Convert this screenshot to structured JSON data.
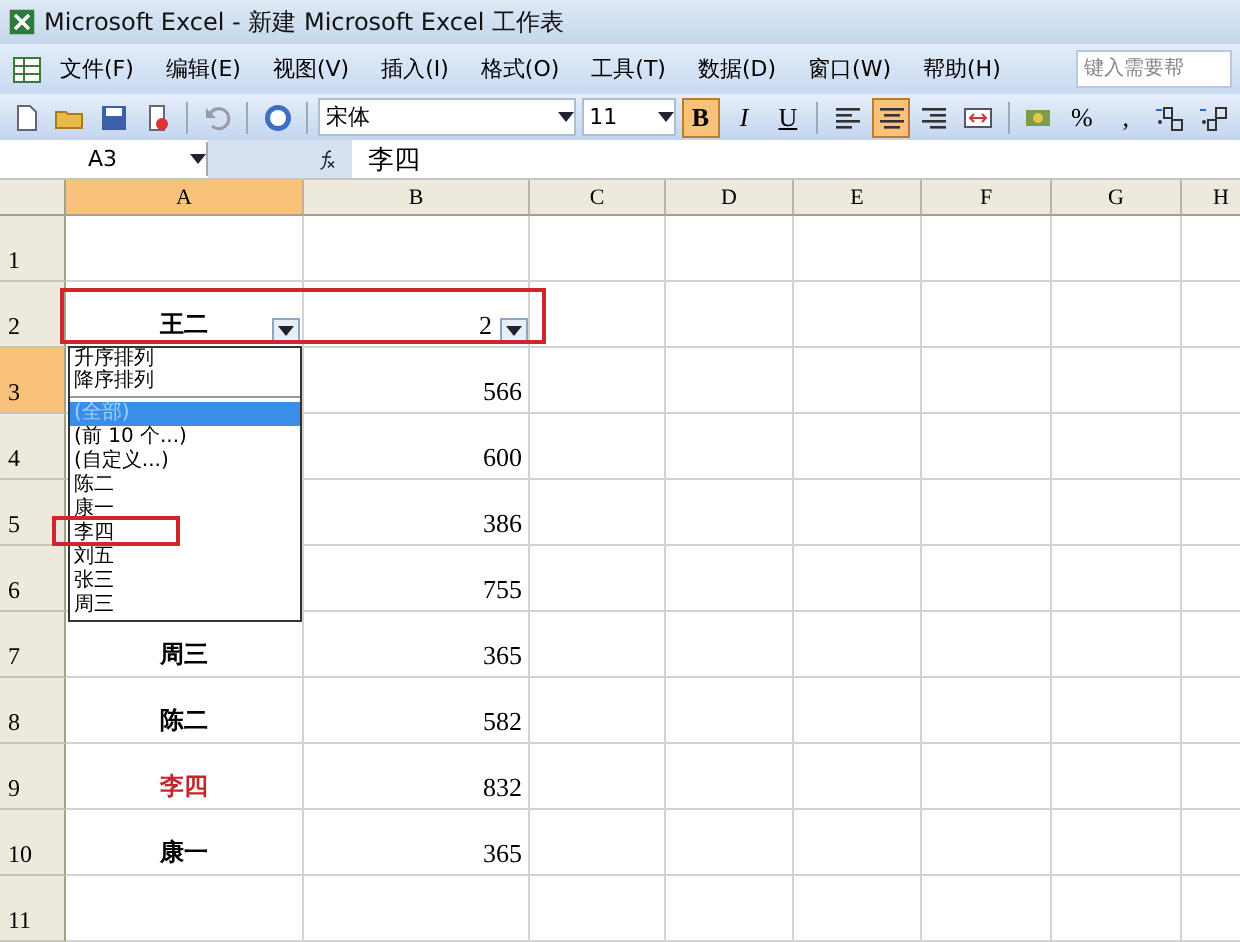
{
  "window": {
    "title": "Microsoft Excel - 新建 Microsoft Excel 工作表"
  },
  "menu": [
    "文件(F)",
    "编辑(E)",
    "视图(V)",
    "插入(I)",
    "格式(O)",
    "工具(T)",
    "数据(D)",
    "窗口(W)",
    "帮助(H)"
  ],
  "help_search": {
    "placeholder": "键入需要帮"
  },
  "toolbar": {
    "font": "宋体",
    "size": "11",
    "format_buttons": [
      {
        "kind": "bold",
        "label": "B",
        "selected": true
      },
      {
        "kind": "italic",
        "label": "I",
        "selected": false
      },
      {
        "kind": "underline",
        "label": "U",
        "selected": false
      }
    ],
    "align_buttons": [
      {
        "kind": "left",
        "selected": false
      },
      {
        "kind": "center",
        "selected": true
      },
      {
        "kind": "right",
        "selected": false
      },
      {
        "kind": "merge",
        "selected": false
      }
    ],
    "number_buttons": [
      {
        "kind": "currency"
      },
      {
        "kind": "text",
        "label": "%"
      },
      {
        "kind": "text",
        "label": ","
      },
      {
        "kind": "increase"
      },
      {
        "kind": "decrease"
      }
    ]
  },
  "formula_bar": {
    "name_box": "A3",
    "value": "李四"
  },
  "columns": [
    {
      "label": "A",
      "selected": true
    },
    {
      "label": "B",
      "selected": false
    },
    {
      "label": "C",
      "selected": false
    },
    {
      "label": "D",
      "selected": false
    },
    {
      "label": "E",
      "selected": false
    },
    {
      "label": "F",
      "selected": false
    },
    {
      "label": "G",
      "selected": false
    },
    {
      "label": "H",
      "selected": false
    }
  ],
  "rows": [
    {
      "label": "1",
      "selected": false,
      "cells": []
    },
    {
      "label": "2",
      "selected": false,
      "filter": true,
      "cells": [
        {
          "text": "王二"
        },
        {
          "text": "2"
        }
      ]
    },
    {
      "label": "3",
      "selected": true,
      "cells": [
        {
          "text": ""
        },
        {
          "text": "566"
        }
      ]
    },
    {
      "label": "4",
      "selected": false,
      "cells": [
        {
          "text": ""
        },
        {
          "text": "600"
        }
      ]
    },
    {
      "label": "5",
      "selected": false,
      "cells": [
        {
          "text": ""
        },
        {
          "text": "386"
        }
      ]
    },
    {
      "label": "6",
      "selected": false,
      "cells": [
        {
          "text": ""
        },
        {
          "text": "755"
        }
      ]
    },
    {
      "label": "7",
      "selected": false,
      "cells": [
        {
          "text": "周三"
        },
        {
          "text": "365"
        }
      ]
    },
    {
      "label": "8",
      "selected": false,
      "cells": [
        {
          "text": "陈二"
        },
        {
          "text": "582"
        }
      ]
    },
    {
      "label": "9",
      "selected": false,
      "cells": [
        {
          "text": "李四",
          "color": "#c0282d"
        },
        {
          "text": "832"
        }
      ]
    },
    {
      "label": "10",
      "selected": false,
      "cells": [
        {
          "text": "康一"
        },
        {
          "text": "365"
        }
      ]
    },
    {
      "label": "11",
      "selected": false,
      "cells": []
    }
  ],
  "filter_dropdown": {
    "items": [
      {
        "kind": "sort",
        "text": "升序排列",
        "selected": false
      },
      {
        "kind": "sort",
        "text": "降序排列",
        "selected": false
      },
      {
        "kind": "option",
        "text": "(全部)",
        "selected": true
      },
      {
        "kind": "option",
        "text": "(前 10 个...)",
        "selected": false
      },
      {
        "kind": "option",
        "text": "(自定义...)",
        "selected": false
      },
      {
        "kind": "option",
        "text": "陈二",
        "selected": false
      },
      {
        "kind": "option",
        "text": "康一",
        "selected": false
      },
      {
        "kind": "option",
        "text": "李四",
        "selected": false
      },
      {
        "kind": "option",
        "text": "刘五",
        "selected": false
      },
      {
        "kind": "option",
        "text": "张三",
        "selected": false
      },
      {
        "kind": "option",
        "text": "周三",
        "selected": false
      }
    ]
  }
}
